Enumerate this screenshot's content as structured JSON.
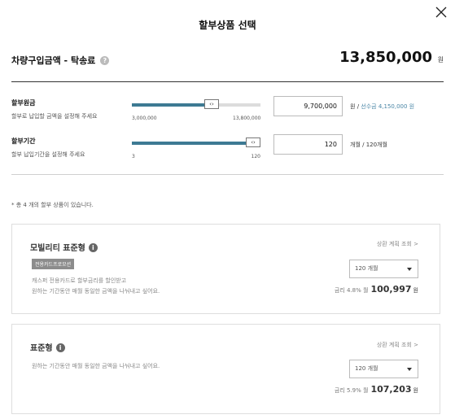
{
  "modal": {
    "title": "할부상품 선택"
  },
  "price": {
    "label": "차량구입금액 - 탁송료",
    "value": "13,850,000",
    "unit": "원"
  },
  "principal": {
    "title": "할부원금",
    "desc": "할부로 납입할 금액을 설정해 주세요",
    "min_label": "3,000,000",
    "max_label": "13,800,000",
    "fill_fraction": 0.62,
    "input_value": "9,700,000",
    "unit": "원",
    "sep": "/",
    "deposit_text": "선수금 4,150,000 원"
  },
  "term": {
    "title": "할부기간",
    "desc": "할부 납입기간을 설정해 주세요",
    "min_label": "3",
    "max_label": "120",
    "fill_fraction": 1.0,
    "input_value": "120",
    "suffix": "개월 / 120개월"
  },
  "products_note": "* 총 4 개의 할부 상품이 있습니다.",
  "products": [
    {
      "title": "모빌리티 표준형",
      "badge": "전용카드프로모션",
      "desc_lines": [
        "캐스퍼 전용카드로 할부금리를 할인받고",
        "원하는 기간동안 매월 동일한 금액을 나눠내고 싶어요."
      ],
      "repay_link": "상환 계획 조회 >",
      "term_option": "120 개월",
      "rate_text": "금리 4.8%",
      "monthly_prefix": "월",
      "monthly_amount": "100,997",
      "monthly_unit": "원"
    },
    {
      "title": "표준형",
      "desc_lines": [
        "원하는 기간동안 매월 동일한 금액을 나눠내고 싶어요."
      ],
      "repay_link": "상환 계획 조회 >",
      "term_option": "120 개월",
      "rate_text": "금리 5.9%",
      "monthly_prefix": "월",
      "monthly_amount": "107,203",
      "monthly_unit": "원"
    }
  ]
}
